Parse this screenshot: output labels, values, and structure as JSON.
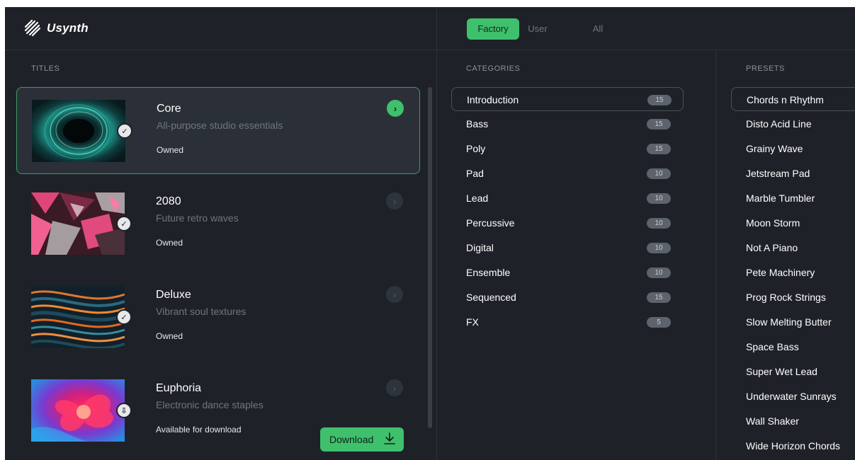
{
  "app": {
    "name": "Usynth"
  },
  "titles": {
    "section_label": "TITLES",
    "items": [
      {
        "name": "Core",
        "subtitle": "All-purpose studio essentials",
        "status": "Owned",
        "selected": true,
        "badge_icon": "check-icon"
      },
      {
        "name": "2080",
        "subtitle": "Future retro waves",
        "status": "Owned",
        "selected": false,
        "badge_icon": "check-icon"
      },
      {
        "name": "Deluxe",
        "subtitle": "Vibrant soul textures",
        "status": "Owned",
        "selected": false,
        "badge_icon": "check-icon"
      },
      {
        "name": "Euphoria",
        "subtitle": "Electronic dance staples",
        "status": "Available for download",
        "selected": false,
        "badge_icon": "cloud-download-icon",
        "action_label": "Download"
      }
    ]
  },
  "source_tabs": {
    "items": [
      {
        "label": "Factory",
        "active": true
      },
      {
        "label": "User",
        "active": false
      },
      {
        "label": "All",
        "active": false
      }
    ]
  },
  "categories": {
    "section_label": "CATEGORIES",
    "items": [
      {
        "label": "Introduction",
        "count": "15",
        "active": true
      },
      {
        "label": "Bass",
        "count": "15"
      },
      {
        "label": "Poly",
        "count": "15"
      },
      {
        "label": "Pad",
        "count": "10"
      },
      {
        "label": "Lead",
        "count": "10"
      },
      {
        "label": "Percussive",
        "count": "10"
      },
      {
        "label": "Digital",
        "count": "10"
      },
      {
        "label": "Ensemble",
        "count": "10"
      },
      {
        "label": "Sequenced",
        "count": "15"
      },
      {
        "label": "FX",
        "count": "5"
      }
    ]
  },
  "presets": {
    "section_label": "PRESETS",
    "items": [
      {
        "label": "Chords n Rhythm",
        "active": true
      },
      {
        "label": "Disto Acid Line"
      },
      {
        "label": "Grainy Wave"
      },
      {
        "label": "Jetstream Pad"
      },
      {
        "label": "Marble Tumbler"
      },
      {
        "label": "Moon Storm"
      },
      {
        "label": "Not A Piano"
      },
      {
        "label": "Pete Machinery"
      },
      {
        "label": "Prog Rock Strings"
      },
      {
        "label": "Slow Melting Butter"
      },
      {
        "label": "Space Bass"
      },
      {
        "label": "Super Wet Lead"
      },
      {
        "label": "Underwater Sunrays"
      },
      {
        "label": "Wall Shaker"
      },
      {
        "label": "Wide Horizon Chords"
      }
    ]
  },
  "colors": {
    "accent": "#3fc06c",
    "background": "#1e2228",
    "selected_card": "#2b3038"
  }
}
